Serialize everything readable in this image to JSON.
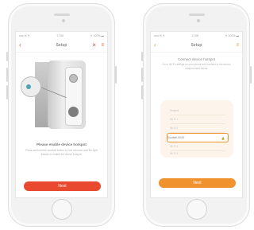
{
  "left_phone": {
    "status": {
      "left": "ooo ✉ ✈",
      "time": "17:06",
      "right": "✈ 100% ▬"
    },
    "nav": {
      "title": "Setup",
      "back_icon": "chevron-left-icon",
      "close_icon": "close-icon",
      "menu_icon": "menu-icon"
    },
    "instruction_title": "Please enable device hotspot",
    "instruction_body": "Press and hold the doorbell button for five seconds until the light flashes to enable the device hotspot.",
    "next_label": "Next"
  },
  "right_phone": {
    "status": {
      "left": "ooo ✉ ✈",
      "time": "17:06",
      "right": "✈ 100% ▬"
    },
    "nav": {
      "title": "Setup",
      "back_icon": "chevron-left-icon",
      "menu_icon": "menu-icon"
    },
    "connect_title": "Connect device hotspot",
    "connect_body": "Go to Wi-Fi settings on your phone and connect to the device hotspot listed below.",
    "wifi_networks": [
      {
        "name": "Hotspot",
        "signal": ""
      },
      {
        "name": "Wi-Fi 1",
        "signal": ""
      },
      {
        "name": "Wi-Fi 2",
        "signal": ""
      },
      {
        "name": "Doorbell-XXXX",
        "signal": "🔒 ◔"
      },
      {
        "name": "Wi-Fi 3",
        "signal": ""
      },
      {
        "name": "Wi-Fi 4",
        "signal": ""
      }
    ],
    "next_label": "Next"
  },
  "colors": {
    "accent_red": "#e8492f",
    "accent_orange": "#f0922e"
  }
}
